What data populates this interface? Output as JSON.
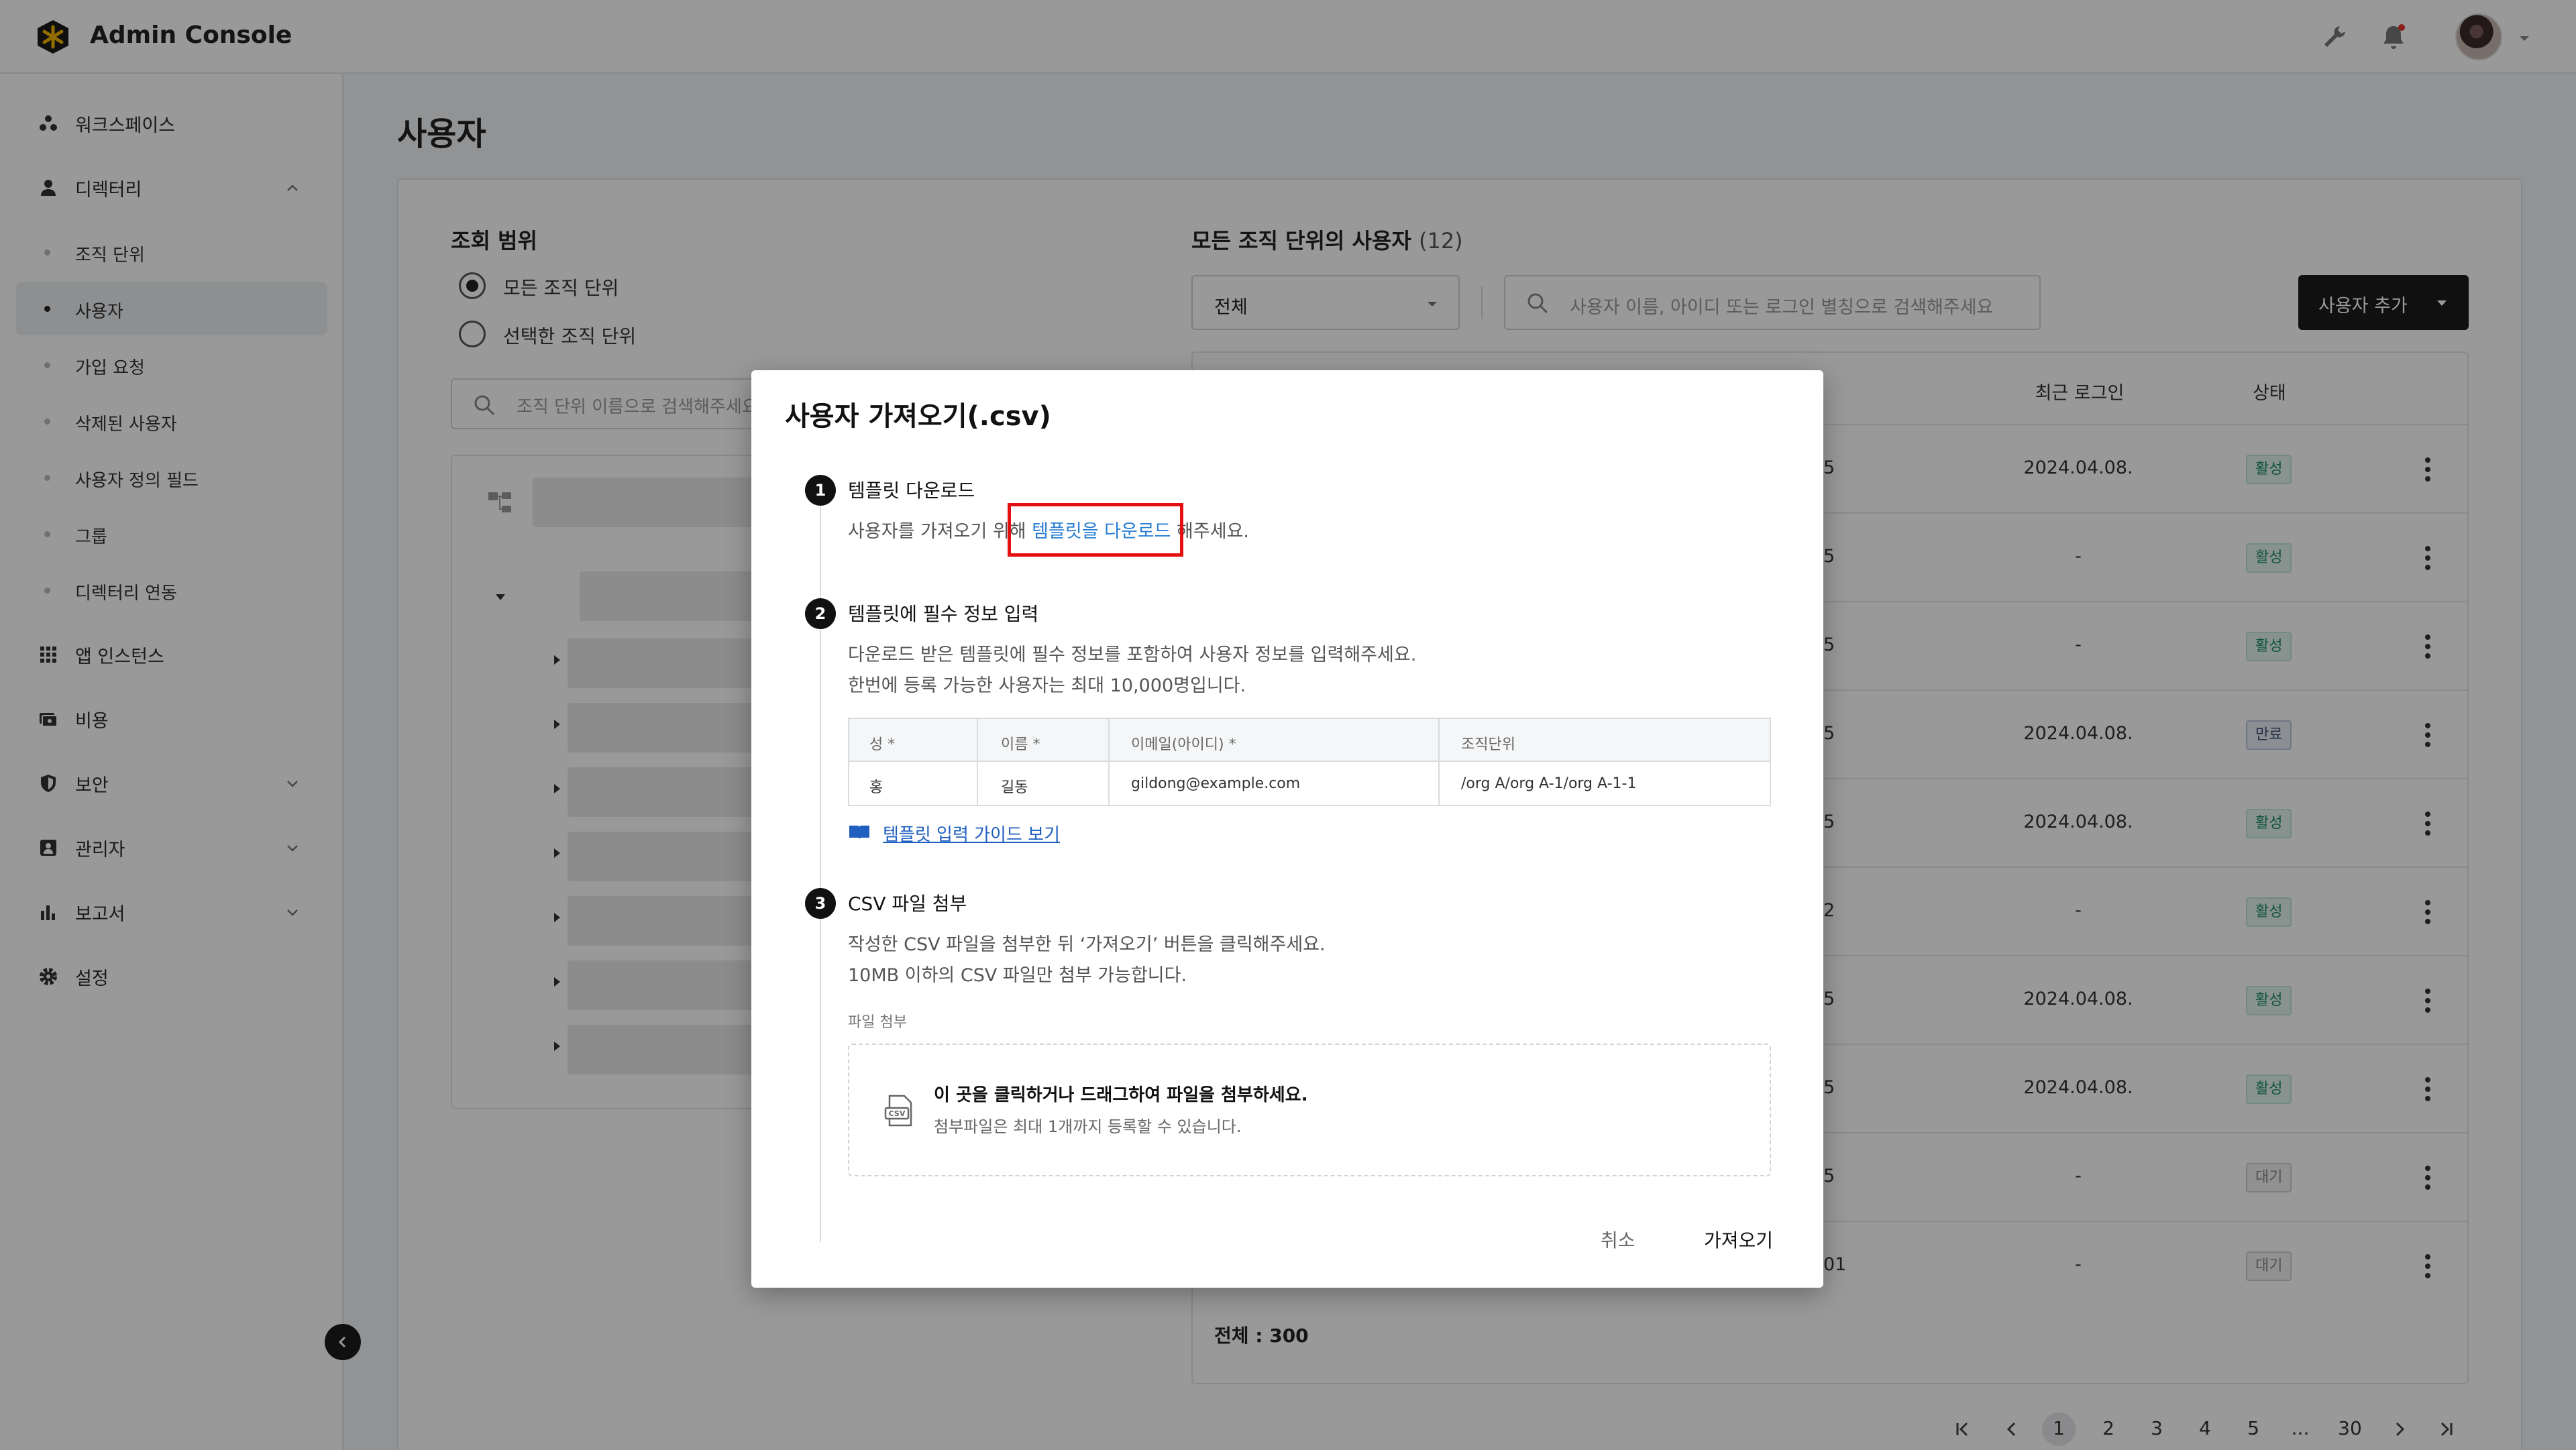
{
  "app": {
    "title": "Admin Console"
  },
  "sidebar": {
    "items": [
      {
        "label": "워크스페이스"
      },
      {
        "label": "디렉터리"
      },
      {
        "label": "앱 인스턴스"
      },
      {
        "label": "비용"
      },
      {
        "label": "보안"
      },
      {
        "label": "관리자"
      },
      {
        "label": "보고서"
      },
      {
        "label": "설정"
      }
    ],
    "sub_items": [
      {
        "label": "조직 단위"
      },
      {
        "label": "사용자"
      },
      {
        "label": "가입 요청"
      },
      {
        "label": "삭제된 사용자"
      },
      {
        "label": "사용자 정의 필드"
      },
      {
        "label": "그룹"
      },
      {
        "label": "디렉터리 연동"
      }
    ]
  },
  "page": {
    "title": "사용자"
  },
  "scope": {
    "title": "조회 범위",
    "options": [
      "모든 조직 단위",
      "선택한 조직 단위"
    ],
    "search_placeholder": "조직 단위 이름으로 검색해주세요"
  },
  "user_list": {
    "title": "모든 조직 단위의 사용자",
    "count": "(12)",
    "filter_value": "전체",
    "search_placeholder": "사용자 이름, 아이디 또는 로그인 별칭으로 검색해주세요",
    "add_button": "사용자 추가",
    "columns": {
      "last_login": "최근 로그인",
      "status": "상태"
    },
    "rows": [
      {
        "id_tail": "5",
        "last_login": "2024.04.08.",
        "status": "활성",
        "kind": "active"
      },
      {
        "id_tail": "5",
        "last_login": "-",
        "status": "활성",
        "kind": "active"
      },
      {
        "id_tail": "5",
        "last_login": "-",
        "status": "활성",
        "kind": "active"
      },
      {
        "id_tail": "5",
        "last_login": "2024.04.08.",
        "status": "만료",
        "kind": "expired"
      },
      {
        "id_tail": "5",
        "last_login": "2024.04.08.",
        "status": "활성",
        "kind": "active"
      },
      {
        "id_tail": "2",
        "last_login": "-",
        "status": "활성",
        "kind": "active"
      },
      {
        "id_tail": "5",
        "last_login": "2024.04.08.",
        "status": "활성",
        "kind": "active"
      },
      {
        "id_tail": "5",
        "last_login": "2024.04.08.",
        "status": "활성",
        "kind": "active"
      },
      {
        "id_tail": "5",
        "last_login": "-",
        "status": "대기",
        "kind": "wait"
      },
      {
        "id_tail": "01",
        "last_login": "-",
        "status": "대기",
        "kind": "wait"
      }
    ],
    "total": "전체 : 300"
  },
  "pagination": {
    "pages": [
      "1",
      "2",
      "3",
      "4",
      "5",
      "...",
      "30"
    ],
    "current": "1"
  },
  "modal": {
    "title": "사용자 가져오기(.csv)",
    "step1": {
      "num": "1",
      "title": "템플릿 다운로드",
      "desc_before": "사용자를 가져오기 위해 ",
      "link": "템플릿을 다운로드",
      "desc_after": " 해주세요."
    },
    "step2": {
      "num": "2",
      "title": "템플릿에 필수 정보 입력",
      "desc1": "다운로드 받은 템플릿에 필수 정보를 포함하여 사용자 정보를 입력해주세요.",
      "desc2": "한번에 등록 가능한 사용자는 최대 10,000명입니다.",
      "table_headers": [
        "성 *",
        "이름 *",
        "이메일(아이디) *",
        "조직단위"
      ],
      "table_row": [
        "홍",
        "길동",
        "gildong@example.com",
        "/org A/org A-1/org A-1-1"
      ],
      "guide_link": "템플릿 입력 가이드 보기"
    },
    "step3": {
      "num": "3",
      "title": "CSV 파일 첨부",
      "desc1": "작성한 CSV 파일을 첨부한 뒤 ‘가져오기’ 버튼을 클릭해주세요.",
      "desc2": "10MB 이하의 CSV 파일만 첨부 가능합니다.",
      "file_label": "파일 첨부",
      "drop_main": "이 곳을 클릭하거나 드래그하여 파일을 첨부하세요.",
      "drop_sub": "첨부파일은 최대 1개까지 등록할 수 있습니다."
    },
    "cancel": "취소",
    "import": "가져오기"
  },
  "colors": {
    "accent": "#1b1b1b",
    "link": "#2a7fd4",
    "highlight": "#e3100f",
    "active_badge": "#1f8a63"
  }
}
